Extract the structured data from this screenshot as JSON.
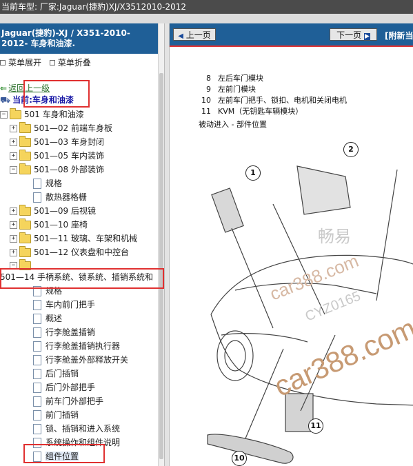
{
  "topbar": {
    "label": "当前车型:",
    "value": "厂家:Jaguar(捷豹)XJ/X3512010-2012"
  },
  "left_header": {
    "line1": "Jaguar(捷豹)-XJ / X351-2010-",
    "line2": "2012- 车身和油漆."
  },
  "menu_ops": {
    "expand": "菜单展开",
    "collapse": "菜单折叠"
  },
  "nav": {
    "back": "返回上一级",
    "current": "当前:车身和油漆"
  },
  "tree": {
    "root": "501 车身和油漆",
    "items": [
      "501—02 前端车身板",
      "501—03 车身封闭",
      "501—05 车内装饰",
      "501—08 外部装饰",
      "规格",
      "散热器格栅",
      "501—09 后视镜",
      "501—10 座椅",
      "501—11 玻璃、车架和机械",
      "501—12 仪表盘和中控台",
      "",
      "501—14 手柄系统、锁系统、插销系统和",
      "规格",
      "车内前门把手",
      "概述",
      "行李舱盖插销",
      "行李舱盖插销执行器",
      "行李舱盖外部释放开关",
      "后门插销",
      "后门外部把手",
      "前车门外部把手",
      "前门插销",
      "锁、插销和进入系统",
      "系统操作和组件说明",
      "组件位置"
    ]
  },
  "viewer": {
    "prev": "上一页",
    "next": "下一页",
    "tag": "[附新当",
    "legend": [
      {
        "num": "8",
        "text": "左后车门模块"
      },
      {
        "num": "9",
        "text": "左前门模块"
      },
      {
        "num": "10",
        "text": "左前车门把手、锁扣、电机和关闭电机"
      },
      {
        "num": "11",
        "text": "KVM（无钥匙车辆模块）"
      }
    ],
    "caption": "被动进入 - 部件位置",
    "callouts": [
      "1",
      "2",
      "11",
      "10"
    ],
    "watermark_main": "car388.com",
    "watermark_sub": "car388.com",
    "watermark_cn": "畅易",
    "watermark_id": "CYZ0165"
  },
  "colors": {
    "header_blue": "#1f5f97",
    "highlight_red": "#e03030"
  }
}
